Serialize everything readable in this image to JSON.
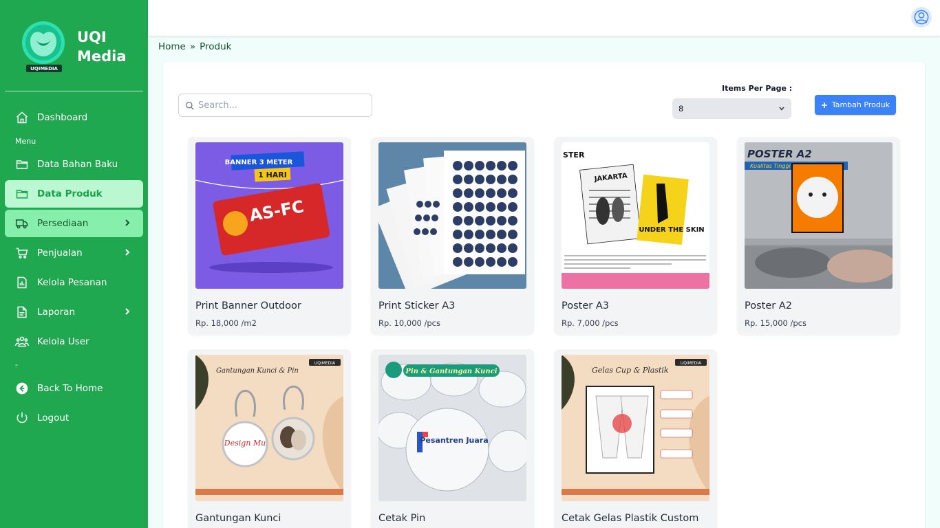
{
  "brand": {
    "name": "UQI Media",
    "logo_text": "UQIMEDIA"
  },
  "sidebar": {
    "items": [
      {
        "label": "Dashboard",
        "icon": "home-icon"
      },
      {
        "label": "Menu"
      },
      {
        "label": "Data Bahan Baku",
        "icon": "folder-icon"
      },
      {
        "label": "Data Produk",
        "icon": "folder-icon",
        "active": true
      },
      {
        "label": "Persediaan",
        "icon": "truck-icon",
        "has_submenu": true
      },
      {
        "label": "Penjualan",
        "icon": "cart-icon",
        "has_submenu": true
      },
      {
        "label": "Kelola Pesanan",
        "icon": "report-icon"
      },
      {
        "label": "Laporan",
        "icon": "document-icon",
        "has_submenu": true
      },
      {
        "label": "Kelola User",
        "icon": "users-icon"
      },
      {
        "label": "-"
      },
      {
        "label": "Back To Home",
        "icon": "arrow-left-circle-icon"
      },
      {
        "label": "Logout",
        "icon": "power-icon"
      }
    ]
  },
  "breadcrumb": {
    "home": "Home",
    "separator": "»",
    "current": "Produk"
  },
  "toolbar": {
    "search_placeholder": "Search...",
    "items_per_page_label": "Items Per Page :",
    "items_per_page_value": "8",
    "add_button_label": "Tambah Produk"
  },
  "products": [
    {
      "name": "Print Banner Outdoor",
      "price": "Rp. 18,000 /m2",
      "image": {
        "headline": "BANNER 3 METER",
        "subline": "1 HARI",
        "brand": "AS-FC"
      }
    },
    {
      "name": "Print Sticker A3",
      "price": "Rp. 10,000 /pcs"
    },
    {
      "name": "Poster A3",
      "price": "Rp. 7,000 /pcs",
      "image": {
        "corner": "STER",
        "event": "JAKARTA",
        "badge": "UNDER THE SKIN"
      }
    },
    {
      "name": "Poster A2",
      "price": "Rp. 15,000 /pcs",
      "image": {
        "headline": "POSTER A2",
        "subline": "Kualitas Tinggi - UV"
      }
    },
    {
      "name": "Gantungan Kunci",
      "price": "",
      "image": {
        "title": "Gantungan Kunci & Pin",
        "badge": "UQIMEDIA",
        "keychain_text": "Design Mu"
      }
    },
    {
      "name": "Cetak Pin",
      "price": "",
      "image": {
        "title": "Pin & Gantungan Kunci",
        "pin_text": "Pesantren Juara"
      }
    },
    {
      "name": "Cetak Gelas Plastik Custom",
      "price": "",
      "image": {
        "title": "Gelas Cup & Plastik",
        "badge": "UQIMEDIA"
      }
    }
  ],
  "colors": {
    "sidebar": "#1fa84f",
    "active_bg": "#bbf7d0",
    "accent": "#3b82f6"
  }
}
